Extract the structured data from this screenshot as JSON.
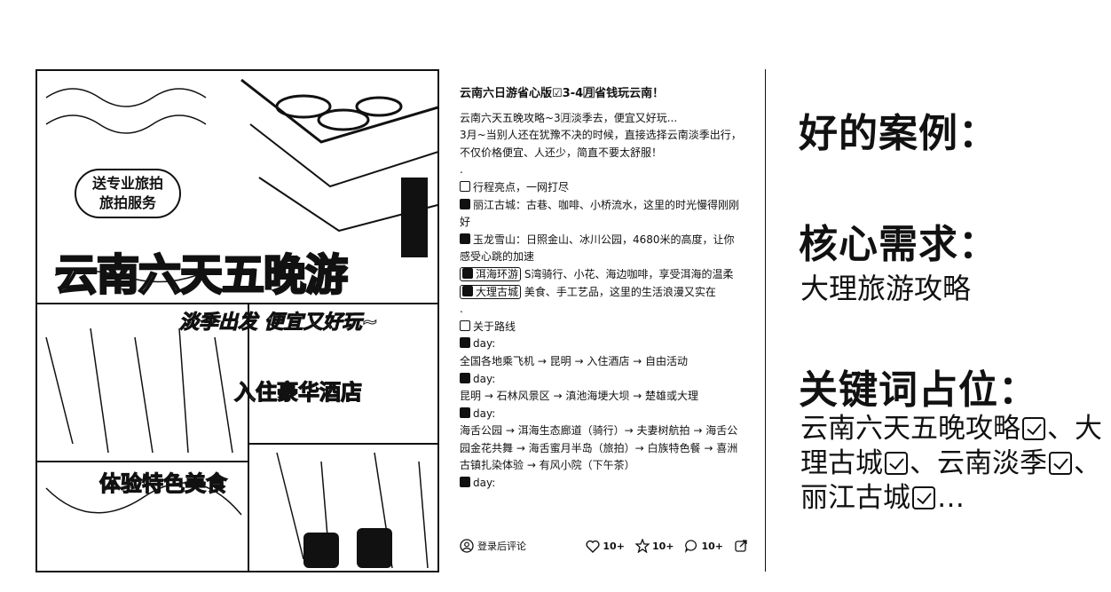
{
  "image": {
    "badge": "送专业旅拍\n旅拍服务",
    "title": "云南六天五晚游",
    "subtitle": "淡季出发 便宜又好玩~",
    "hotel": "入住豪华酒店",
    "food": "体验特色美食"
  },
  "post": {
    "title": "云南六日游省心版☑3-4🈷省钱玩云南！",
    "intro": [
      "云南六天五晚攻略~3🈷淡季去，便宜又好玩...",
      "3月~当别人还在犹豫不决的时候，直接选择云南淡季出行，不仅价格便宜、人还少，简直不要太舒服！",
      "."
    ],
    "highlights_head": "行程亮点，一网打尽",
    "highlights": [
      {
        "name": "丽江古城",
        "text": "：古巷、咖啡、小桥流水，这里的时光慢得刚刚好",
        "boxed": false
      },
      {
        "name": "玉龙雪山",
        "text": "：日照金山、冰川公园，4680米的高度，让你感受心跳的加速",
        "boxed": false
      },
      {
        "name": "洱海环游",
        "text": "S湾骑行、小花、海边咖啡，享受洱海的温柔",
        "boxed": true
      },
      {
        "name": "大理古城",
        "text": "美食、手工艺品，这里的生活浪漫又实在",
        "boxed": true
      }
    ],
    "dot": ".",
    "route_head": "关于路线",
    "days": [
      {
        "label": "day:",
        "route": "全国各地乘飞机 → 昆明 → 入住酒店 → 自由活动"
      },
      {
        "label": "day:",
        "route": "昆明 → 石林风景区 → 滇池海埂大坝 → 楚雄或大理"
      },
      {
        "label": "day:",
        "route": "海舌公园 → 洱海生态廊道（骑行）→ 夫妻树航拍 → 海舌公园金花共舞 → 海舌蜜月半岛（旅拍）→ 白族特色餐 → 喜洲古镇扎染体验 → 有风小院（下午茶）"
      },
      {
        "label": "day:",
        "route": ""
      }
    ],
    "comment_label": "登录后评论",
    "likes": "10+",
    "stars": "10+",
    "comments": "10+"
  },
  "notes": {
    "case_heading": "好的案例：",
    "need_heading": "核心需求：",
    "need_value": "大理旅游攻略",
    "kw_heading": "关键词占位：",
    "keywords": [
      "云南六天五晚攻略",
      "、",
      "大理古城",
      "、云南淡季",
      "、丽江古城",
      "…"
    ]
  }
}
